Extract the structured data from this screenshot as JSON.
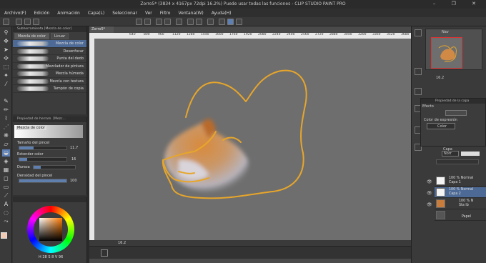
{
  "window": {
    "title": "Zorro5* (3834 x 4167px 72dpi 16.2%)  Puede usar todas las funciones - CLIP STUDIO PAINT PRO",
    "controls": "–  ❐  ✕"
  },
  "menu": [
    "Archivo(F)",
    "Edición",
    "Animación",
    "Capa(L)",
    "Seleccionar",
    "Ver",
    "Filtro",
    "Ventana(W)",
    "Ayuda(H)"
  ],
  "subtool": {
    "header": "Subherramienta [Mezcla de color]",
    "tabs": [
      "Mezcla de color",
      "Licuar"
    ],
    "brushes": [
      "Mezcla de color",
      "Desenfocar",
      "Punta del dedo",
      "Mezclador de pintura",
      "Mezcla húmeda",
      "Mezcla con textura",
      "Tampón de copia"
    ],
    "selected_index": 0
  },
  "tool_property": {
    "header": "Propiedad de herram. [Mezc...",
    "preset_name": "Mezcla de color",
    "brush_size_label": "Tamaño del pincel",
    "brush_size_value": "11.7",
    "brush_size_fill": 0.3,
    "extend_color_label": "Extender color",
    "extend_color_value": "16",
    "extend_color_fill": 0.16,
    "hardness_label": "Dureza",
    "density_label": "Densidad del pincel",
    "density_value": "100",
    "density_fill": 1.0
  },
  "color": {
    "main": "#f1c9b4",
    "sub": "#ffffff",
    "readout": [
      "H",
      "28",
      "S",
      "8",
      "V",
      "96"
    ]
  },
  "canvas": {
    "tab_label": "Zorro5*",
    "ruler_ticks": [
      "640",
      "800",
      "960",
      "1120",
      "1280",
      "1440",
      "1600",
      "1760",
      "1920",
      "2080",
      "2240",
      "2400",
      "2560",
      "2720",
      "2880",
      "3040",
      "3200",
      "3360",
      "3520",
      "3680"
    ],
    "zoom_value": "16.2",
    "line_color": "#e7a62b",
    "background": "#6e6e6e"
  },
  "navigator": {
    "tab": "Nav",
    "zoom": "16.2"
  },
  "layer_property": {
    "header": "Propiedad de la capa",
    "effect_label": "Efecto",
    "expression_label": "Color de expresión",
    "expression_value": "Color"
  },
  "layers": {
    "tab": "Capa",
    "blend_mode": "Norr",
    "items": [
      {
        "line1": "100 % Normal",
        "line2": "Capa 1",
        "selected": false
      },
      {
        "line1": "100 % Normal",
        "line2": "Capa 2",
        "selected": true
      },
      {
        "line1": "100 % N",
        "line2": "Sta lb",
        "selected": false
      },
      {
        "line1": "",
        "line2": "Papel",
        "selected": false
      }
    ]
  }
}
